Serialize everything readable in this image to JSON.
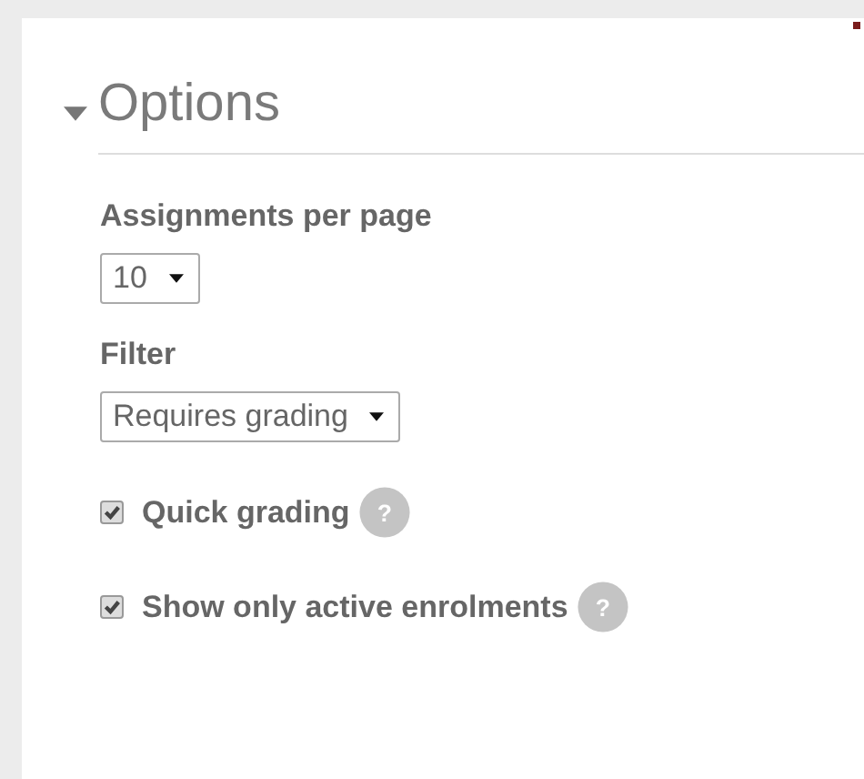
{
  "section": {
    "title": "Options",
    "expanded": true
  },
  "fields": [
    {
      "kind": "select",
      "label": "Assignments per page",
      "value": "10"
    },
    {
      "kind": "select",
      "label": "Filter",
      "value": "Requires grading"
    },
    {
      "kind": "checkbox",
      "label": "Quick grading",
      "checked": true,
      "help": "?"
    },
    {
      "kind": "checkbox",
      "label": "Show only active enrolments",
      "checked": true,
      "help": "?"
    }
  ]
}
